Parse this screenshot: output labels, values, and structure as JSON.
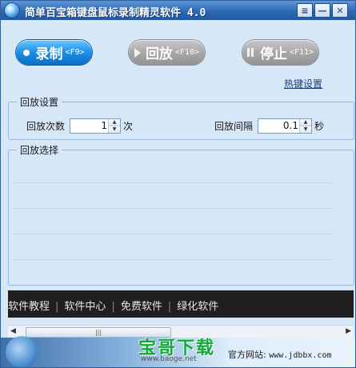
{
  "window": {
    "title": "简单百宝箱键盘鼠标录制精灵软件 4.0",
    "controls": {
      "menu": "≡",
      "minimize": "—",
      "close": "✕"
    }
  },
  "toolbar": {
    "record": {
      "label": "录制",
      "hotkey": "<F9>"
    },
    "play": {
      "label": "回放",
      "hotkey": "<F10>"
    },
    "stop": {
      "label": "停止",
      "hotkey": "<F11>"
    }
  },
  "hotkey_settings_link": "热键设置",
  "playback_settings": {
    "group_title": "回放设置",
    "count_label": "回放次数",
    "count_value": "1",
    "count_unit": "次",
    "interval_label": "回放间隔",
    "interval_value": "0.1",
    "interval_unit": "秒"
  },
  "playback_selection": {
    "group_title": "回放选择"
  },
  "banner": {
    "links": [
      "软件教程",
      "软件中心",
      "免费软件",
      "绿化软件"
    ]
  },
  "footer": {
    "watermark": "宝哥下载",
    "watermark_url": "www.baoge.net",
    "official_label": "官方网站:",
    "official_url": "www.jdbbx.com"
  },
  "colors": {
    "accent": "#1b8ee6",
    "title_bar": "#2d68b4",
    "window_bg": "#d6e7f7"
  }
}
